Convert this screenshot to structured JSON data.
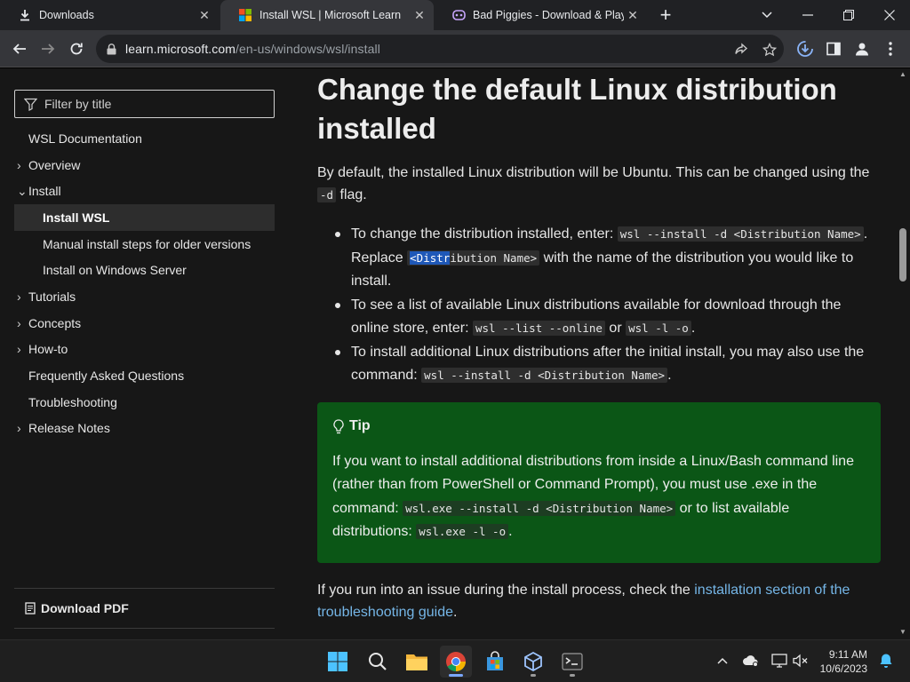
{
  "tabs": [
    {
      "title": "Downloads",
      "close": "✕"
    },
    {
      "title": "Install WSL | Microsoft Learn",
      "close": "✕"
    },
    {
      "title": "Bad Piggies - Download & Play",
      "close": "✕"
    }
  ],
  "new_tab": "+",
  "url": {
    "host": "learn.microsoft.com",
    "path": "/en-us/windows/wsl/install"
  },
  "sidebar": {
    "filter_placeholder": "Filter by title",
    "items": [
      {
        "label": "WSL Documentation",
        "chev": ""
      },
      {
        "label": "Overview",
        "chev": "›"
      },
      {
        "label": "Install",
        "chev": "⌄"
      },
      {
        "label": "Install WSL",
        "chev": ""
      },
      {
        "label": "Manual install steps for older versions",
        "chev": ""
      },
      {
        "label": "Install on Windows Server",
        "chev": ""
      },
      {
        "label": "Tutorials",
        "chev": "›"
      },
      {
        "label": "Concepts",
        "chev": "›"
      },
      {
        "label": "How-to",
        "chev": "›"
      },
      {
        "label": "Frequently Asked Questions",
        "chev": ""
      },
      {
        "label": "Troubleshooting",
        "chev": ""
      },
      {
        "label": "Release Notes",
        "chev": "›"
      }
    ],
    "download_pdf": "Download PDF"
  },
  "article": {
    "heading": "Change the default Linux distribution installed",
    "intro_before": "By default, the installed Linux distribution will be Ubuntu. This can be changed using the ",
    "intro_code": "-d",
    "intro_after": " flag.",
    "bullet1_a": "To change the distribution installed, enter: ",
    "bullet1_code": "wsl --install -d <Distribution Name>",
    "bullet1_b": ". Replace ",
    "bullet1_code2_sel": "<Distr",
    "bullet1_code2_rest": "ibution Name>",
    "bullet1_c": " with the name of the distribution you would like to install.",
    "bullet2_a": "To see a list of available Linux distributions available for download through the online store, enter: ",
    "bullet2_code": "wsl --list --online",
    "bullet2_b": " or ",
    "bullet2_code2": "wsl -l -o",
    "bullet2_c": ".",
    "bullet3_a": "To install additional Linux distributions after the initial install, you may also use the command: ",
    "bullet3_code": "wsl --install -d <Distribution Name>",
    "bullet3_b": ".",
    "tip_title": "Tip",
    "tip_a": "If you want to install additional distributions from inside a Linux/Bash command line (rather than from PowerShell or Command Prompt), you must use .exe in the command: ",
    "tip_code": "wsl.exe --install -d <Distribution Name>",
    "tip_b": " or to list available distributions: ",
    "tip_code2": "wsl.exe -l -o",
    "tip_c": ".",
    "outro_a": "If you run into an issue during the install process, check the ",
    "outro_link": "installation section of the troubleshooting guide",
    "outro_b": "."
  },
  "taskbar": {
    "time": "9:11 AM",
    "date": "10/6/2023"
  },
  "colors": {
    "tip_bg": "#0b5616",
    "link": "#75b6e7",
    "selection": "#1f58b8"
  }
}
